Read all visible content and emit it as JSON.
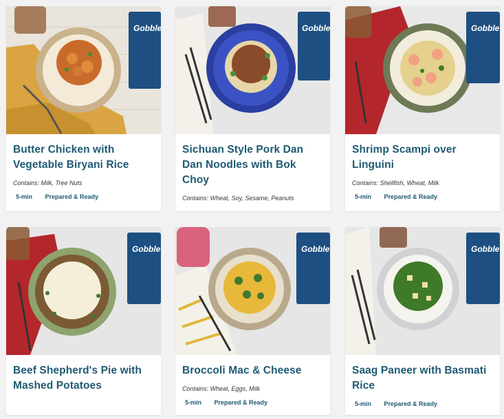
{
  "brand": "Gobble",
  "meals": [
    {
      "title": "Butter Chicken with Vegetable Biryani Rice",
      "contains_label": "Contains:",
      "contains": "Milk, Tree Nuts",
      "time": "5-min",
      "badge": "Prepared & Ready"
    },
    {
      "title": "Sichuan Style Pork Dan Dan Noodles with Bok Choy",
      "contains_label": "Contains:",
      "contains": "Wheat, Soy, Sesame, Peanuts",
      "time": "",
      "badge": ""
    },
    {
      "title": "Shrimp Scampi over Linguini",
      "contains_label": "Contains:",
      "contains": "Shellfish, Wheat, Milk",
      "time": "5-min",
      "badge": "Prepared & Ready"
    },
    {
      "title": "Beef Shepherd's Pie with Mashed Potatoes",
      "contains_label": "",
      "contains": "",
      "time": "",
      "badge": ""
    },
    {
      "title": "Broccoli Mac & Cheese",
      "contains_label": "Contains:",
      "contains": "Wheat, Eggs, Milk",
      "time": "5-min",
      "badge": "Prepared & Ready"
    },
    {
      "title": "Saag Paneer with Basmati Rice",
      "contains_label": "",
      "contains": "",
      "time": "5-min",
      "badge": "Prepared & Ready"
    }
  ],
  "colors": {
    "title": "#1f5a73",
    "package": "#1d4f82",
    "background": "#f2f2f2"
  }
}
